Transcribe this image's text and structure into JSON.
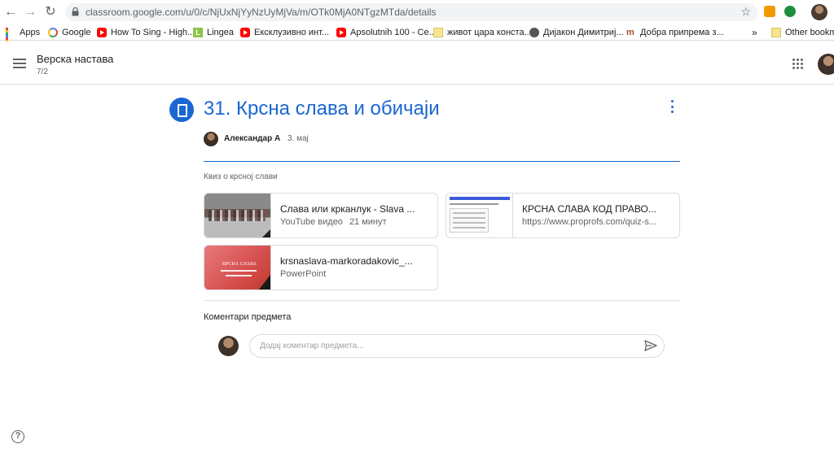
{
  "browser": {
    "url": "classroom.google.com/u/0/c/NjUxNjYyNzUyMjVa/m/OTk0MjA0NTgzMTda/details",
    "bookmarks": [
      {
        "label": "Apps",
        "icon": "apps-icon"
      },
      {
        "label": "Google",
        "icon": "google-icon"
      },
      {
        "label": "How To Sing - High...",
        "icon": "youtube-icon"
      },
      {
        "label": "Lingea",
        "icon": "lingea-icon"
      },
      {
        "label": "Ексклузивно инт...",
        "icon": "youtube-icon"
      },
      {
        "label": "Apsolutnih 100 - Ce...",
        "icon": "youtube-icon"
      },
      {
        "label": "живот цара конста...",
        "icon": "folder-icon"
      },
      {
        "label": "Дијакон Димитриј...",
        "icon": "site-icon"
      },
      {
        "label": "Добра припрема з...",
        "icon": "m-icon"
      }
    ],
    "overflow_chevron": "»",
    "other_bookmarks": "Other bookma"
  },
  "classroom": {
    "class_name": "Верска настава",
    "section": "7/2"
  },
  "assignment": {
    "title": "31. Крсна слава и обичаји",
    "author": "Александар А",
    "date": "3. мај",
    "description": "Квиз о крсној слави"
  },
  "attachments": [
    {
      "title": "Слава или крканлук - Slava ...",
      "type": "YouTube видео",
      "meta": "21 минут"
    },
    {
      "title": "КРСНА СЛАВА КОД ПРАВО...",
      "type": "https://www.proprofs.com/quiz-s...",
      "meta": ""
    },
    {
      "title": "krsnaslava-markoradakovic_...",
      "type": "PowerPoint",
      "meta": ""
    }
  ],
  "ppt_thumb_text": "КРСНА СЛАВА",
  "comments": {
    "label": "Коментари предмета",
    "placeholder": "Додај коментар предмета..."
  },
  "colors": {
    "accent": "#1967d2",
    "youtube": "#ff0000"
  }
}
